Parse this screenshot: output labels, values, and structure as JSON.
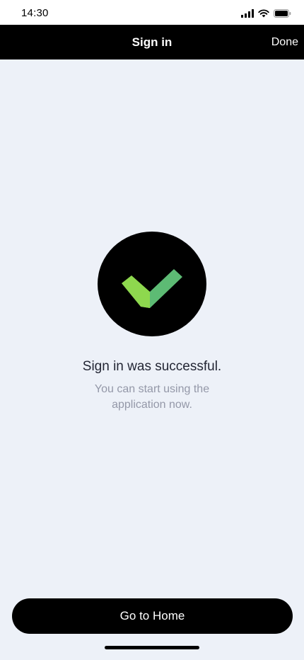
{
  "status_bar": {
    "time": "14:30",
    "icons": [
      "signal-icon",
      "wifi-icon",
      "battery-icon"
    ]
  },
  "nav": {
    "title": "Sign in",
    "done_label": "Done"
  },
  "success": {
    "icon": "check-icon",
    "headline": "Sign in was successful.",
    "subtext": "You can start using the application now."
  },
  "actions": {
    "home_label": "Go to Home"
  },
  "colors": {
    "nav_background": "#000000",
    "content_background": "#edf1f8",
    "check_light": "#8ed84e",
    "check_dark": "#5dbb74",
    "headline": "#232634",
    "subtext": "#9498a8"
  }
}
